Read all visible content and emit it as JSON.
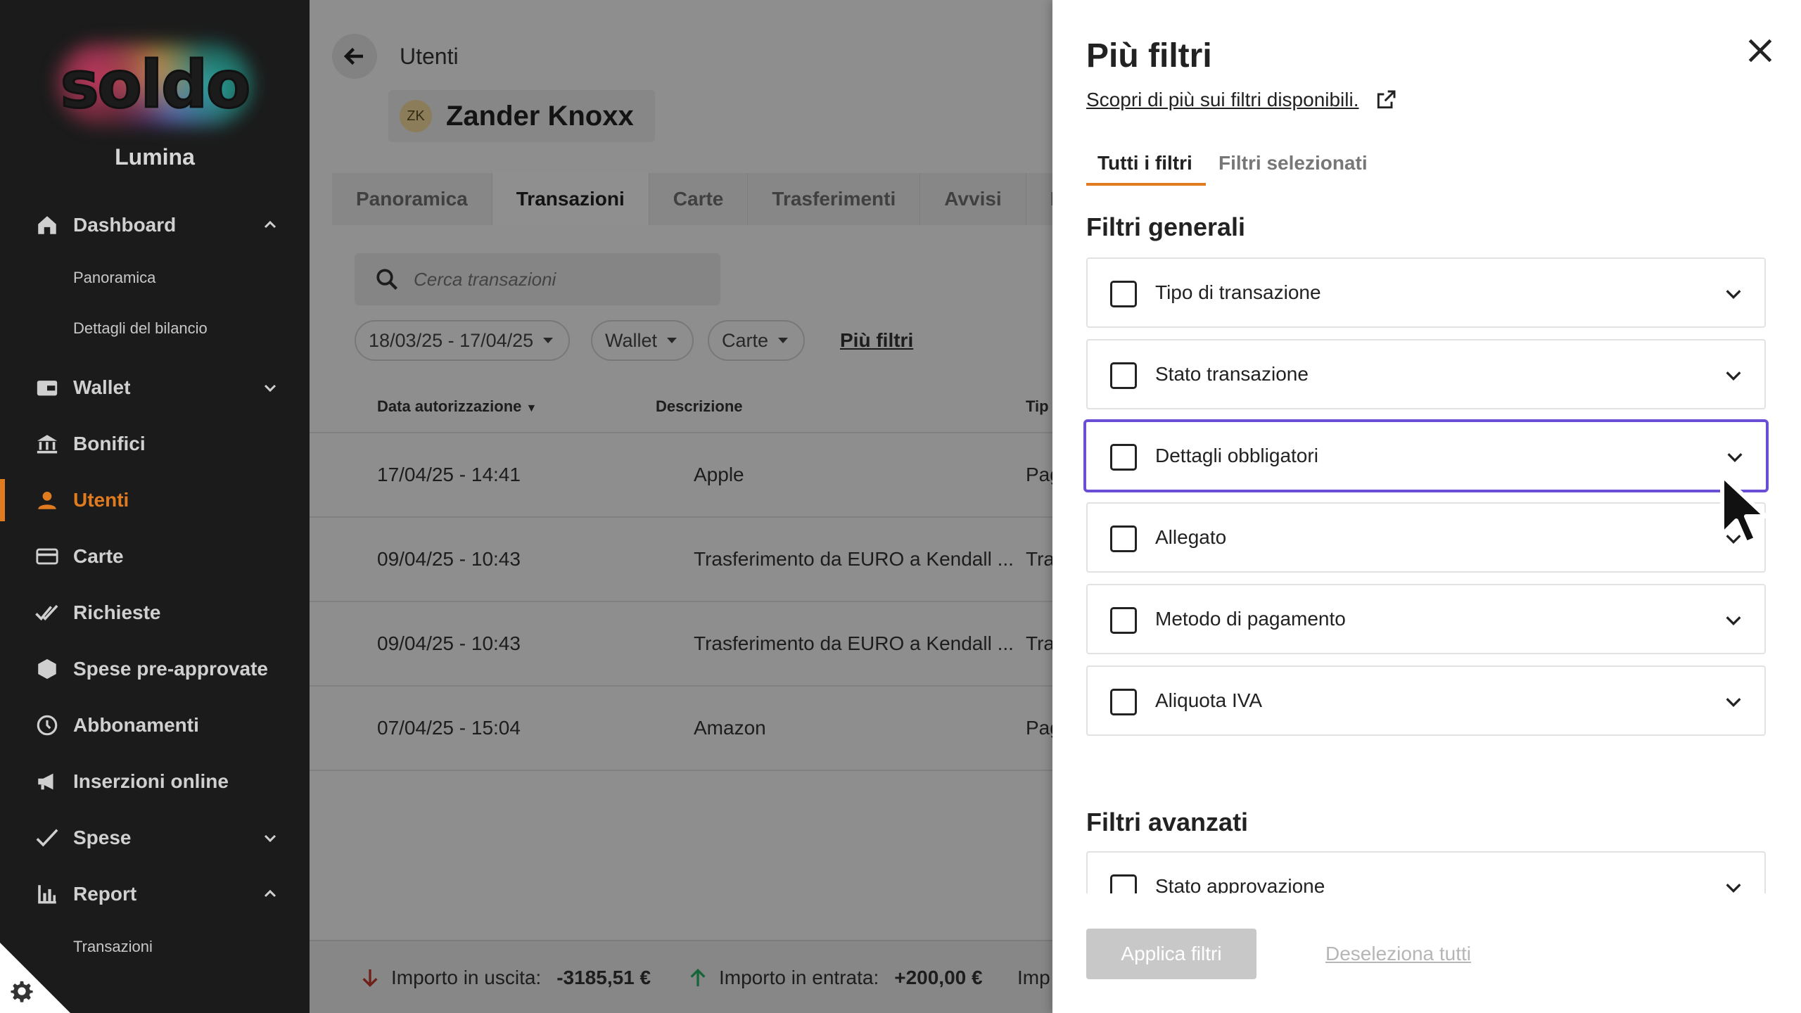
{
  "sidebar": {
    "logo": "soldo",
    "org_name": "Lumina",
    "items": [
      {
        "label": "Dashboard"
      },
      {
        "label": "Wallet"
      },
      {
        "label": "Bonifici"
      },
      {
        "label": "Utenti"
      },
      {
        "label": "Carte"
      },
      {
        "label": "Richieste"
      },
      {
        "label": "Spese pre-approvate"
      },
      {
        "label": "Abbonamenti"
      },
      {
        "label": "Inserzioni online"
      },
      {
        "label": "Spese"
      },
      {
        "label": "Report"
      }
    ],
    "dashboard_sub": [
      "Panoramica",
      "Dettagli del bilancio"
    ],
    "report_sub": [
      "Transazioni"
    ],
    "accent_color": "#e07b1f"
  },
  "main": {
    "breadcrumb": "Utenti",
    "user": {
      "initials": "ZK",
      "name": "Zander Knoxx"
    },
    "tabs": [
      "Panoramica",
      "Transazioni",
      "Carte",
      "Trasferimenti",
      "Avvisi",
      "Inf"
    ],
    "active_tab": "Transazioni",
    "search_placeholder": "Cerca transazioni",
    "chips": {
      "date": "18/03/25 - 17/04/25",
      "wallet": "Wallet",
      "cards": "Carte"
    },
    "more_filters": "Più filtri",
    "columns": [
      "Data autorizzazione",
      "Descrizione",
      "Tip"
    ],
    "rows": [
      {
        "date": "17/04/25 - 14:41",
        "desc": "Apple",
        "type": "Pag"
      },
      {
        "date": "09/04/25 - 10:43",
        "desc": "Trasferimento da EURO a Kendall ...",
        "type": "Tra"
      },
      {
        "date": "09/04/25 - 10:43",
        "desc": "Trasferimento da EURO a Kendall ...",
        "type": "Tra"
      },
      {
        "date": "07/04/25 - 15:04",
        "desc": "Amazon",
        "type": "Pag"
      }
    ],
    "footer": {
      "out_label": "Importo in uscita:",
      "out_value": "-3185,51 €",
      "in_label": "Importo in entrata:",
      "in_value": "+200,00 €",
      "more": "Imp"
    }
  },
  "panel": {
    "title": "Più filtri",
    "learn_link": "Scopri di più sui filtri disponibili.",
    "tabs": [
      "Tutti i filtri",
      "Filtri selezionati"
    ],
    "general_title": "Filtri generali",
    "general_filters": [
      "Tipo di transazione",
      "Stato transazione",
      "Dettagli obbligatori",
      "Allegato",
      "Metodo di pagamento",
      "Aliquota IVA"
    ],
    "advanced_title": "Filtri avanzati",
    "advanced_filters": [
      "Stato approvazione"
    ],
    "apply": "Applica filtri",
    "deselect": "Deseleziona tutti",
    "focus_color": "#6a4fd6"
  }
}
